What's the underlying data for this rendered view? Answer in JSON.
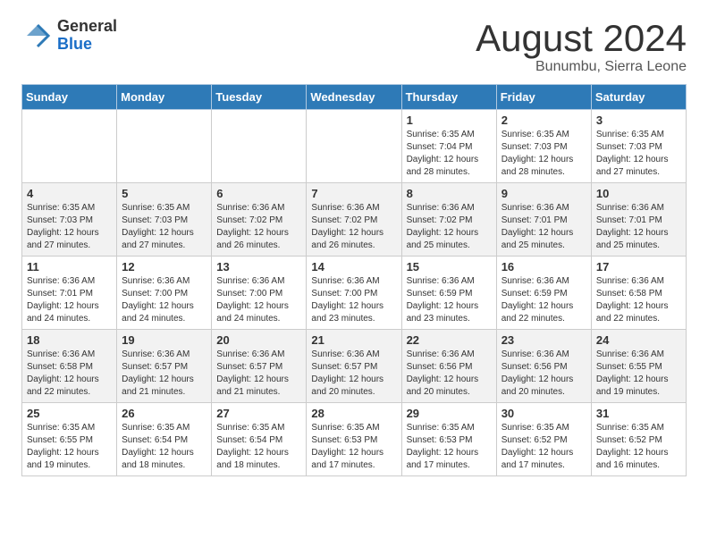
{
  "logo": {
    "general": "General",
    "blue": "Blue"
  },
  "title": "August 2024",
  "subtitle": "Bunumbu, Sierra Leone",
  "days_header": [
    "Sunday",
    "Monday",
    "Tuesday",
    "Wednesday",
    "Thursday",
    "Friday",
    "Saturday"
  ],
  "weeks": [
    [
      {
        "day": "",
        "info": ""
      },
      {
        "day": "",
        "info": ""
      },
      {
        "day": "",
        "info": ""
      },
      {
        "day": "",
        "info": ""
      },
      {
        "day": "1",
        "info": "Sunrise: 6:35 AM\nSunset: 7:04 PM\nDaylight: 12 hours\nand 28 minutes."
      },
      {
        "day": "2",
        "info": "Sunrise: 6:35 AM\nSunset: 7:03 PM\nDaylight: 12 hours\nand 28 minutes."
      },
      {
        "day": "3",
        "info": "Sunrise: 6:35 AM\nSunset: 7:03 PM\nDaylight: 12 hours\nand 27 minutes."
      }
    ],
    [
      {
        "day": "4",
        "info": "Sunrise: 6:35 AM\nSunset: 7:03 PM\nDaylight: 12 hours\nand 27 minutes."
      },
      {
        "day": "5",
        "info": "Sunrise: 6:35 AM\nSunset: 7:03 PM\nDaylight: 12 hours\nand 27 minutes."
      },
      {
        "day": "6",
        "info": "Sunrise: 6:36 AM\nSunset: 7:02 PM\nDaylight: 12 hours\nand 26 minutes."
      },
      {
        "day": "7",
        "info": "Sunrise: 6:36 AM\nSunset: 7:02 PM\nDaylight: 12 hours\nand 26 minutes."
      },
      {
        "day": "8",
        "info": "Sunrise: 6:36 AM\nSunset: 7:02 PM\nDaylight: 12 hours\nand 25 minutes."
      },
      {
        "day": "9",
        "info": "Sunrise: 6:36 AM\nSunset: 7:01 PM\nDaylight: 12 hours\nand 25 minutes."
      },
      {
        "day": "10",
        "info": "Sunrise: 6:36 AM\nSunset: 7:01 PM\nDaylight: 12 hours\nand 25 minutes."
      }
    ],
    [
      {
        "day": "11",
        "info": "Sunrise: 6:36 AM\nSunset: 7:01 PM\nDaylight: 12 hours\nand 24 minutes."
      },
      {
        "day": "12",
        "info": "Sunrise: 6:36 AM\nSunset: 7:00 PM\nDaylight: 12 hours\nand 24 minutes."
      },
      {
        "day": "13",
        "info": "Sunrise: 6:36 AM\nSunset: 7:00 PM\nDaylight: 12 hours\nand 24 minutes."
      },
      {
        "day": "14",
        "info": "Sunrise: 6:36 AM\nSunset: 7:00 PM\nDaylight: 12 hours\nand 23 minutes."
      },
      {
        "day": "15",
        "info": "Sunrise: 6:36 AM\nSunset: 6:59 PM\nDaylight: 12 hours\nand 23 minutes."
      },
      {
        "day": "16",
        "info": "Sunrise: 6:36 AM\nSunset: 6:59 PM\nDaylight: 12 hours\nand 22 minutes."
      },
      {
        "day": "17",
        "info": "Sunrise: 6:36 AM\nSunset: 6:58 PM\nDaylight: 12 hours\nand 22 minutes."
      }
    ],
    [
      {
        "day": "18",
        "info": "Sunrise: 6:36 AM\nSunset: 6:58 PM\nDaylight: 12 hours\nand 22 minutes."
      },
      {
        "day": "19",
        "info": "Sunrise: 6:36 AM\nSunset: 6:57 PM\nDaylight: 12 hours\nand 21 minutes."
      },
      {
        "day": "20",
        "info": "Sunrise: 6:36 AM\nSunset: 6:57 PM\nDaylight: 12 hours\nand 21 minutes."
      },
      {
        "day": "21",
        "info": "Sunrise: 6:36 AM\nSunset: 6:57 PM\nDaylight: 12 hours\nand 20 minutes."
      },
      {
        "day": "22",
        "info": "Sunrise: 6:36 AM\nSunset: 6:56 PM\nDaylight: 12 hours\nand 20 minutes."
      },
      {
        "day": "23",
        "info": "Sunrise: 6:36 AM\nSunset: 6:56 PM\nDaylight: 12 hours\nand 20 minutes."
      },
      {
        "day": "24",
        "info": "Sunrise: 6:36 AM\nSunset: 6:55 PM\nDaylight: 12 hours\nand 19 minutes."
      }
    ],
    [
      {
        "day": "25",
        "info": "Sunrise: 6:35 AM\nSunset: 6:55 PM\nDaylight: 12 hours\nand 19 minutes."
      },
      {
        "day": "26",
        "info": "Sunrise: 6:35 AM\nSunset: 6:54 PM\nDaylight: 12 hours\nand 18 minutes."
      },
      {
        "day": "27",
        "info": "Sunrise: 6:35 AM\nSunset: 6:54 PM\nDaylight: 12 hours\nand 18 minutes."
      },
      {
        "day": "28",
        "info": "Sunrise: 6:35 AM\nSunset: 6:53 PM\nDaylight: 12 hours\nand 17 minutes."
      },
      {
        "day": "29",
        "info": "Sunrise: 6:35 AM\nSunset: 6:53 PM\nDaylight: 12 hours\nand 17 minutes."
      },
      {
        "day": "30",
        "info": "Sunrise: 6:35 AM\nSunset: 6:52 PM\nDaylight: 12 hours\nand 17 minutes."
      },
      {
        "day": "31",
        "info": "Sunrise: 6:35 AM\nSunset: 6:52 PM\nDaylight: 12 hours\nand 16 minutes."
      }
    ]
  ]
}
